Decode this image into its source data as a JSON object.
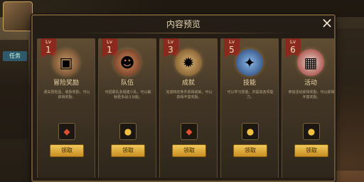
{
  "modal": {
    "title": "内容预览",
    "close_symbol": "×"
  },
  "cards": [
    {
      "lv_label": "Lv",
      "level": "1",
      "name": "冒险奖励",
      "desc": "通关冒险后，收获奖励，可以获得奖励。",
      "icon": "chest-icon",
      "reward_icon": "red-gem-icon",
      "button": "领取",
      "color": "#b08050"
    },
    {
      "lv_label": "Lv",
      "level": "1",
      "name": "队伍",
      "desc": "可招募队友组建小队，可以解锁更多战斗功能。",
      "icon": "team-icon",
      "reward_icon": "gold-coins-icon",
      "button": "领取",
      "color": "#a05a3a"
    },
    {
      "lv_label": "Lv",
      "level": "3",
      "name": "成就",
      "desc": "完成特定条件获得成就，可以获得丰富奖励。",
      "icon": "medal-icon",
      "reward_icon": "red-gem-icon",
      "button": "领取",
      "color": "#8c6a3a"
    },
    {
      "lv_label": "Lv",
      "level": "5",
      "name": "技能",
      "desc": "可以学习技能，并提高各项能力。",
      "icon": "skill-book-icon",
      "reward_icon": "gold-coins-icon",
      "button": "领取",
      "color": "#3a5a8a"
    },
    {
      "lv_label": "Lv",
      "level": "6",
      "name": "活动",
      "desc": "参加活动获得奖励，可以获得丰富奖励。",
      "icon": "calendar-icon",
      "reward_icon": "gold-coins-icon",
      "button": "领取",
      "color": "#b03a3a"
    }
  ],
  "hud": {
    "side_tab": "任务"
  }
}
